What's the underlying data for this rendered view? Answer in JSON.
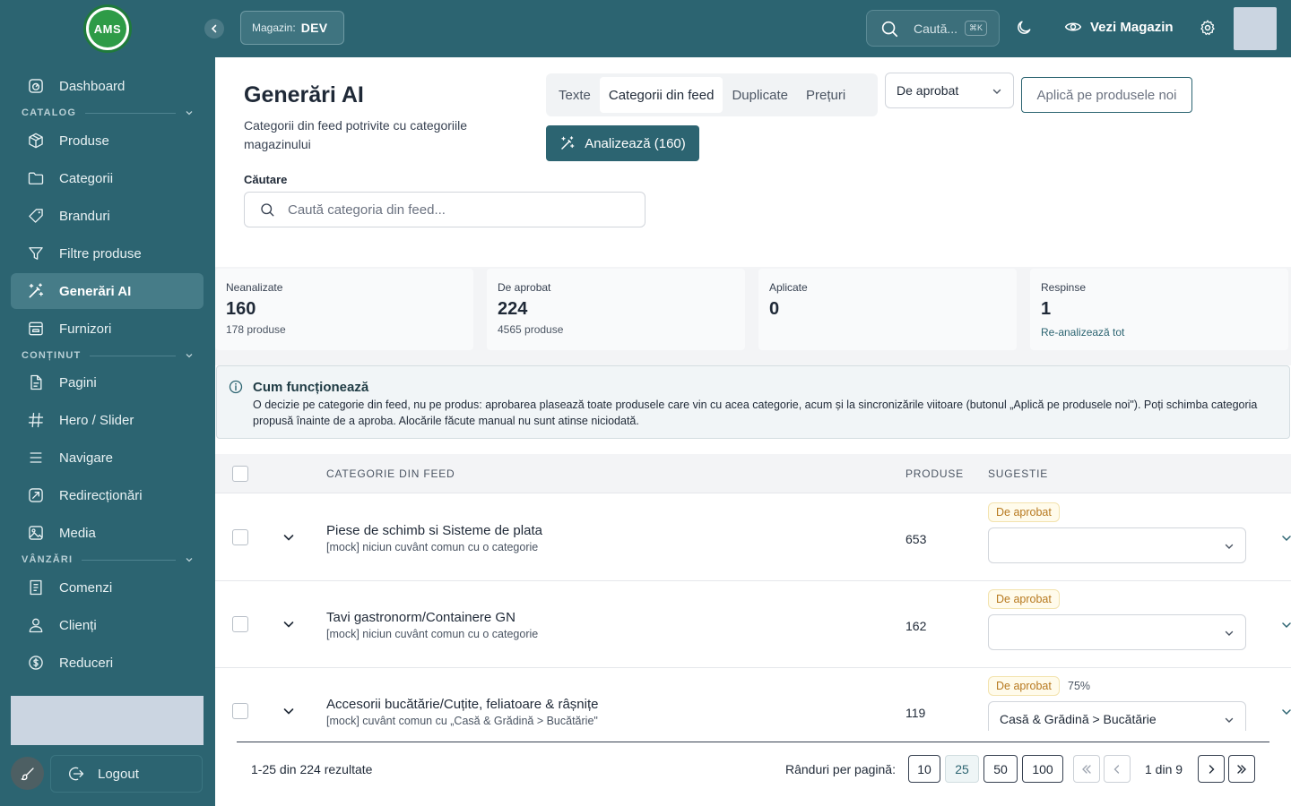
{
  "topbar": {
    "logo_text": "AMS",
    "store_label": "Magazin:",
    "store_value": "DEV",
    "search_placeholder": "Caută...",
    "search_shortcut": "⌘K",
    "view_store": "Vezi Magazin",
    "brand_color": "#2c6471"
  },
  "sidebar": {
    "dashboard": "Dashboard",
    "sections": {
      "catalog": "CATALOG",
      "content": "CONȚINUT",
      "sales": "VÂNZĂRI"
    },
    "items": {
      "produse": "Produse",
      "categorii": "Categorii",
      "branduri": "Branduri",
      "filtre": "Filtre produse",
      "generari": "Generări AI",
      "furnizori": "Furnizori",
      "pagini": "Pagini",
      "hero": "Hero / Slider",
      "navigare": "Navigare",
      "redirectionari": "Redirecționări",
      "media": "Media",
      "comenzi": "Comenzi",
      "clienti": "Clienți",
      "reduceri": "Reduceri"
    },
    "logout": "Logout"
  },
  "page": {
    "title": "Generări AI",
    "subtitle": "Categorii din feed potrivite cu categoriile magazinului",
    "tabs": [
      "Texte",
      "Categorii din feed",
      "Duplicate",
      "Prețuri"
    ],
    "active_tab": "Categorii din feed",
    "status_filter": "De aprobat",
    "apply_button": "Aplică pe produsele noi",
    "analyze_button": "Analizează (160)",
    "search_label": "Căutare",
    "search_placeholder": "Caută categoria din feed..."
  },
  "stats": [
    {
      "label": "Neanalizate",
      "value": "160",
      "sub": "178 produse"
    },
    {
      "label": "De aprobat",
      "value": "224",
      "sub": "4565 produse"
    },
    {
      "label": "Aplicate",
      "value": "0",
      "sub": ""
    },
    {
      "label": "Respinse",
      "value": "1",
      "link": "Re-analizează tot"
    }
  ],
  "info": {
    "title": "Cum funcționează",
    "body": "O decizie pe categorie din feed, nu pe produs: aprobarea plasează toate produsele care vin cu acea categorie, acum și la sincronizările viitoare (butonul „Aplică pe produsele noi\"). Poți schimba categoria propusă înainte de a aproba. Alocările făcute manual nu sunt atinse niciodată."
  },
  "table": {
    "headers": {
      "category": "CATEGORIE DIN FEED",
      "products": "PRODUSE",
      "suggestion": "SUGESTIE"
    },
    "rows": [
      {
        "name": "Piese de schimb si Sisteme de plata",
        "note": "[mock] niciun cuvânt comun cu o categorie",
        "count": "653",
        "badge": "De aprobat",
        "percent": "",
        "suggestion": ""
      },
      {
        "name": "Tavi gastronorm/Containere GN",
        "note": "[mock] niciun cuvânt comun cu o categorie",
        "count": "162",
        "badge": "De aprobat",
        "percent": "",
        "suggestion": ""
      },
      {
        "name": "Accesorii bucătărie/Cuțite, feliatoare & râșnițe",
        "note": "[mock] cuvânt comun cu „Casă & Grădină > Bucătărie\"",
        "count": "119",
        "badge": "De aprobat",
        "percent": "75%",
        "suggestion": "Casă & Grădină > Bucătărie"
      }
    ]
  },
  "footer": {
    "results": "1-25 din 224 rezultate",
    "rows_per_page_label": "Rânduri per pagină:",
    "page_sizes": [
      "10",
      "25",
      "50",
      "100"
    ],
    "selected_page_size": "25",
    "page_info": "1 din 9"
  }
}
